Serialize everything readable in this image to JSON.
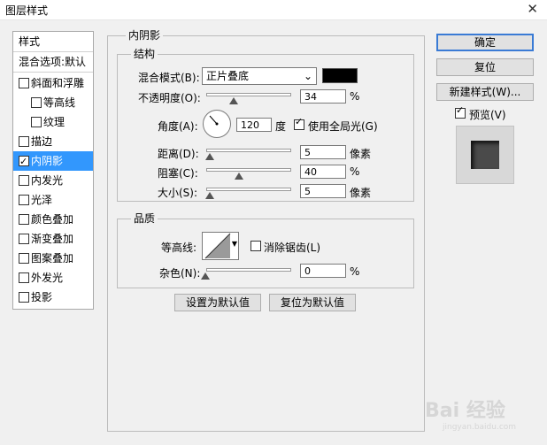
{
  "window": {
    "title": "图层样式",
    "close_glyph": "✕"
  },
  "styles_list": {
    "header": "样式",
    "blend_options": "混合选项:默认",
    "items": [
      {
        "label": "斜面和浮雕",
        "checked": false,
        "sub": false
      },
      {
        "label": "等高线",
        "checked": false,
        "sub": true
      },
      {
        "label": "纹理",
        "checked": false,
        "sub": true
      },
      {
        "label": "描边",
        "checked": false,
        "sub": false
      },
      {
        "label": "内阴影",
        "checked": true,
        "sub": false,
        "selected": true
      },
      {
        "label": "内发光",
        "checked": false,
        "sub": false
      },
      {
        "label": "光泽",
        "checked": false,
        "sub": false
      },
      {
        "label": "颜色叠加",
        "checked": false,
        "sub": false
      },
      {
        "label": "渐变叠加",
        "checked": false,
        "sub": false
      },
      {
        "label": "图案叠加",
        "checked": false,
        "sub": false
      },
      {
        "label": "外发光",
        "checked": false,
        "sub": false
      },
      {
        "label": "投影",
        "checked": false,
        "sub": false
      }
    ]
  },
  "panel": {
    "title": "内阴影",
    "structure": {
      "title": "结构",
      "blend_mode_label": "混合模式(B):",
      "blend_mode_value": "正片叠底",
      "shadow_color": "#000000",
      "opacity_label": "不透明度(O):",
      "opacity_value": "34",
      "opacity_unit": "%",
      "angle_label": "角度(A):",
      "angle_value": "120",
      "angle_unit": "度",
      "global_light_label": "使用全局光(G)",
      "global_light_checked": true,
      "distance_label": "距离(D):",
      "distance_value": "5",
      "distance_unit": "像素",
      "choke_label": "阻塞(C):",
      "choke_value": "40",
      "choke_unit": "%",
      "size_label": "大小(S):",
      "size_value": "5",
      "size_unit": "像素"
    },
    "quality": {
      "title": "品质",
      "contour_label": "等高线:",
      "anti_alias_label": "消除锯齿(L)",
      "anti_alias_checked": false,
      "noise_label": "杂色(N):",
      "noise_value": "0",
      "noise_unit": "%"
    },
    "make_default_label": "设置为默认值",
    "reset_default_label": "复位为默认值"
  },
  "buttons": {
    "ok": "确定",
    "reset": "复位",
    "new_style": "新建样式(W)...",
    "preview_label": "预览(V)",
    "preview_checked": true
  },
  "watermark": {
    "text": "Bai 经验",
    "sub": "jingyan.baidu.com"
  }
}
